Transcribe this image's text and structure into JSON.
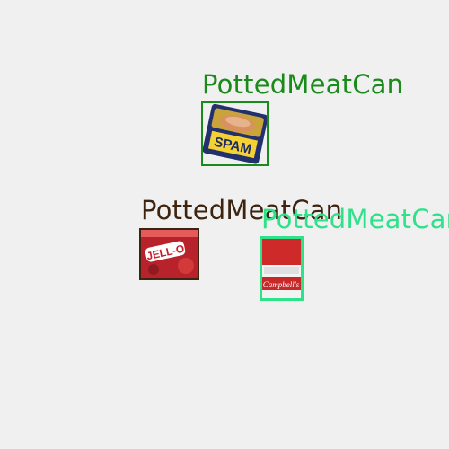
{
  "detections": [
    {
      "label": "PottedMeatCan",
      "color": "#1a8a1a"
    },
    {
      "label": "PottedMeatCan",
      "color": "#3d2410"
    },
    {
      "label": "PottedMeatCan",
      "color": "#2ee28a"
    }
  ],
  "objects": [
    {
      "kind": "spam-can",
      "icon": "spam-can-icon",
      "text": "SPAM"
    },
    {
      "kind": "jello-box",
      "icon": "jello-box-icon",
      "text": "JELL-O"
    },
    {
      "kind": "tomato-soup-can",
      "icon": "soup-can-icon",
      "text": "Campbell's"
    }
  ]
}
